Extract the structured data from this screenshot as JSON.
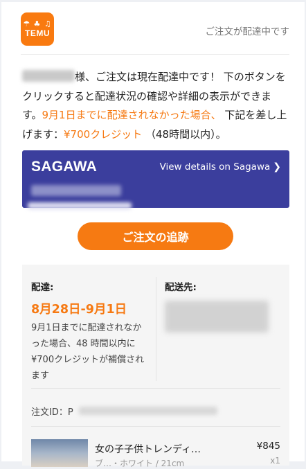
{
  "header": {
    "logo_text": "TEMU",
    "logo_icons": "☂ ♣ ♫",
    "status": "ご注文が配達中です"
  },
  "message": {
    "part1": "様、ご注文は現在配達中です！ 下のボタンをクリックすると配達状況の確認や詳細の表示ができます。",
    "part2": "9月1日までに配達されなかった場合、",
    "part3": "下記を差し上げます：",
    "part4": "¥700クレジット",
    "part5": "（48時間以内）。"
  },
  "carrier": {
    "brand": "SAGAWA",
    "link_label": "View details on Sagawa",
    "chevron": "❯"
  },
  "track_button": "ご注文の追跡",
  "delivery": {
    "label": "配達:",
    "date_range": "8月28日-9月1日",
    "note": "9月1日までに配達されなかった場合、48 時間以内に¥700クレジットが補償されます"
  },
  "destination": {
    "label": "配送先:"
  },
  "order": {
    "id_label": "注文ID：P"
  },
  "item": {
    "name": "女の子子供トレンディ…",
    "sub": "ブ…・ホワイト / 21cm",
    "price": "¥845",
    "qty": "x1"
  },
  "colors": {
    "accent": "#f67912",
    "carrier_bg": "#3b3e9d"
  }
}
